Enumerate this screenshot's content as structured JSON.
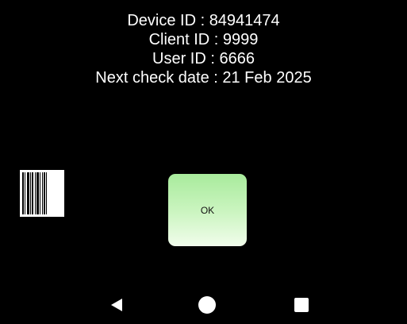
{
  "device_info": {
    "device_id": "Device ID : 84941474",
    "client_id": "Client ID : 9999",
    "user_id": "User ID : 6666",
    "next_check": "Next check date : 21 Feb 2025"
  },
  "ok_button": {
    "label": "OK"
  },
  "barcode": {
    "icon": "barcode-icon"
  },
  "navigation": {
    "back_icon": "back-triangle-icon",
    "home_icon": "home-circle-icon",
    "recents_icon": "recents-square-icon"
  },
  "colors": {
    "background": "#000000",
    "text": "#ffffff",
    "ok_button_top": "#a8eb9c",
    "ok_button_bottom": "#f1fdec"
  }
}
